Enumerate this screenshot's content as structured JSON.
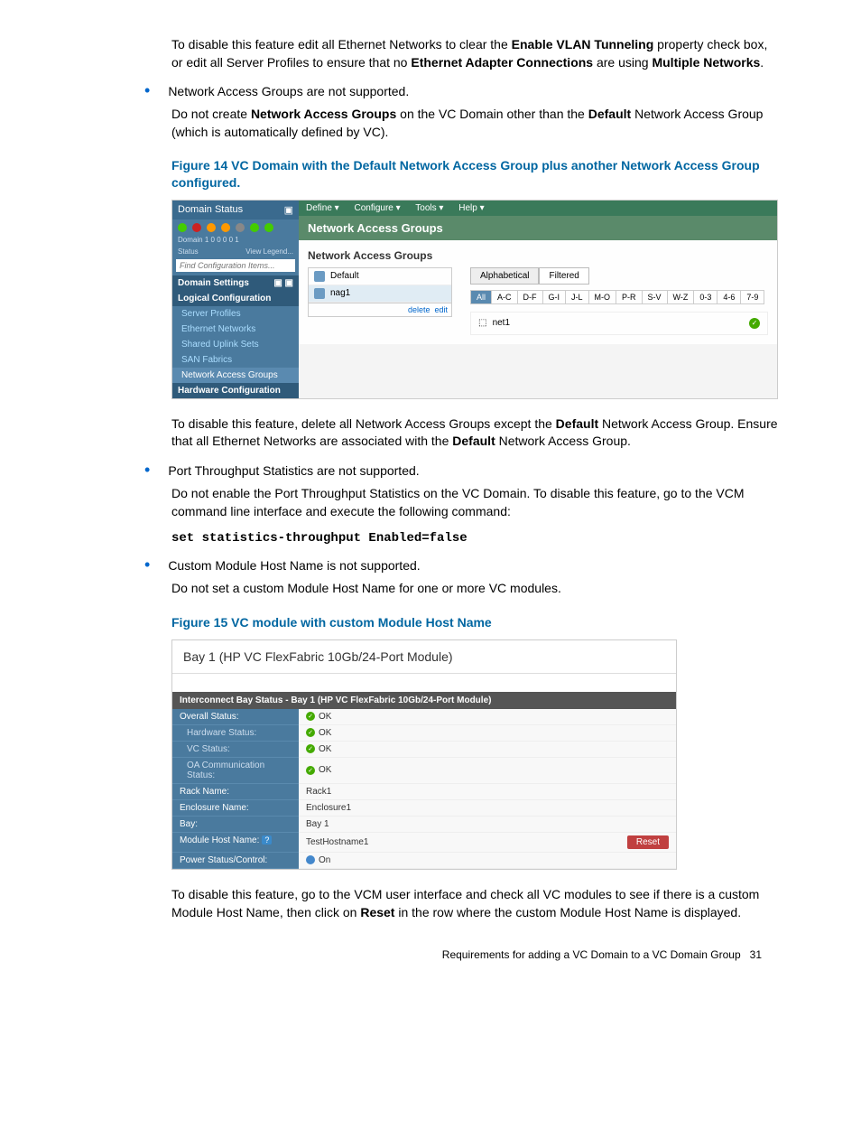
{
  "body": {
    "p1a": "To disable this feature edit all Ethernet Networks to clear the ",
    "p1b": "Enable VLAN Tunneling",
    "p1c": " property check box, or edit all Server Profiles to ensure that no ",
    "p1d": "Ethernet Adapter Connections",
    "p1e": " are using ",
    "p1f": "Multiple Networks",
    "p1g": ".",
    "bullet2": "Network Access Groups are not supported.",
    "p2a": "Do not create ",
    "p2b": "Network Access Groups",
    "p2c": " on the VC Domain other than the ",
    "p2d": "Default",
    "p2e": " Network Access Group (which is automatically defined by VC).",
    "fig14_caption": "Figure 14 VC Domain with the Default Network Access Group plus another Network Access Group configured.",
    "p3a": "To disable this feature, delete all Network Access Groups except the ",
    "p3b": "Default",
    "p3c": " Network Access Group. Ensure that all Ethernet Networks are associated with the ",
    "p3d": "Default",
    "p3e": " Network Access Group.",
    "bullet3": "Port Throughput Statistics are not supported.",
    "p4": "Do not enable the Port Throughput Statistics on the VC Domain. To disable this feature, go to the VCM command line interface and execute the following command:",
    "code1": "set statistics-throughput Enabled=false",
    "bullet4": "Custom Module Host Name is not supported.",
    "p5": "Do not set a custom Module Host Name for one or more VC modules.",
    "fig15_caption": "Figure 15 VC module with custom Module Host Name",
    "p6a": "To disable this feature, go to the VCM user interface and check all VC modules to see if there is a custom Module Host Name, then click on ",
    "p6b": "Reset",
    "p6c": " in the row where the custom Module Host Name is displayed.",
    "footer_text": "Requirements for adding a VC Domain to a VC Domain Group",
    "footer_page": "31"
  },
  "fig14": {
    "ds_header": "Domain Status",
    "status_cols": [
      "1",
      "0",
      "0",
      "0",
      "0",
      "1"
    ],
    "domain_lbl": "Domain",
    "status_lbl": "Status",
    "legend": "View Legend...",
    "search_placeholder": "Find Configuration Items...",
    "sections": {
      "domain_settings": "Domain Settings",
      "logical_config": "Logical Configuration",
      "hardware_config": "Hardware Configuration"
    },
    "lc_items": [
      "Server Profiles",
      "Ethernet Networks",
      "Shared Uplink Sets",
      "SAN Fabrics",
      "Network Access Groups"
    ],
    "menu": [
      "Define ▾",
      "Configure ▾",
      "Tools ▾",
      "Help ▾"
    ],
    "main_title": "Network Access Groups",
    "subtitle": "Network Access Groups",
    "list_items": [
      "Default",
      "nag1"
    ],
    "list_actions": [
      "delete",
      "edit"
    ],
    "tabs": [
      "Alphabetical",
      "Filtered"
    ],
    "filters": [
      "All",
      "A-C",
      "D-F",
      "G-I",
      "J-L",
      "M-O",
      "P-R",
      "S-V",
      "W-Z",
      "0-3",
      "4-6",
      "7-9"
    ],
    "net_name": "net1"
  },
  "fig15": {
    "title": "Bay 1 (HP VC FlexFabric 10Gb/24-Port Module)",
    "subheader": "Interconnect Bay Status - Bay 1 (HP VC FlexFabric 10Gb/24-Port Module)",
    "rows": {
      "overall": {
        "label": "Overall Status:",
        "val": "OK"
      },
      "hardware": {
        "label": "Hardware Status:",
        "val": "OK"
      },
      "vc": {
        "label": "VC Status:",
        "val": "OK"
      },
      "oa": {
        "label": "OA Communication Status:",
        "val": "OK"
      },
      "rack": {
        "label": "Rack Name:",
        "val": "Rack1"
      },
      "enc": {
        "label": "Enclosure Name:",
        "val": "Enclosure1"
      },
      "bay": {
        "label": "Bay:",
        "val": "Bay 1"
      },
      "host": {
        "label": "Module Host Name:",
        "val": "TestHostname1",
        "reset": "Reset"
      },
      "power": {
        "label": "Power Status/Control:",
        "val": "On"
      }
    }
  }
}
